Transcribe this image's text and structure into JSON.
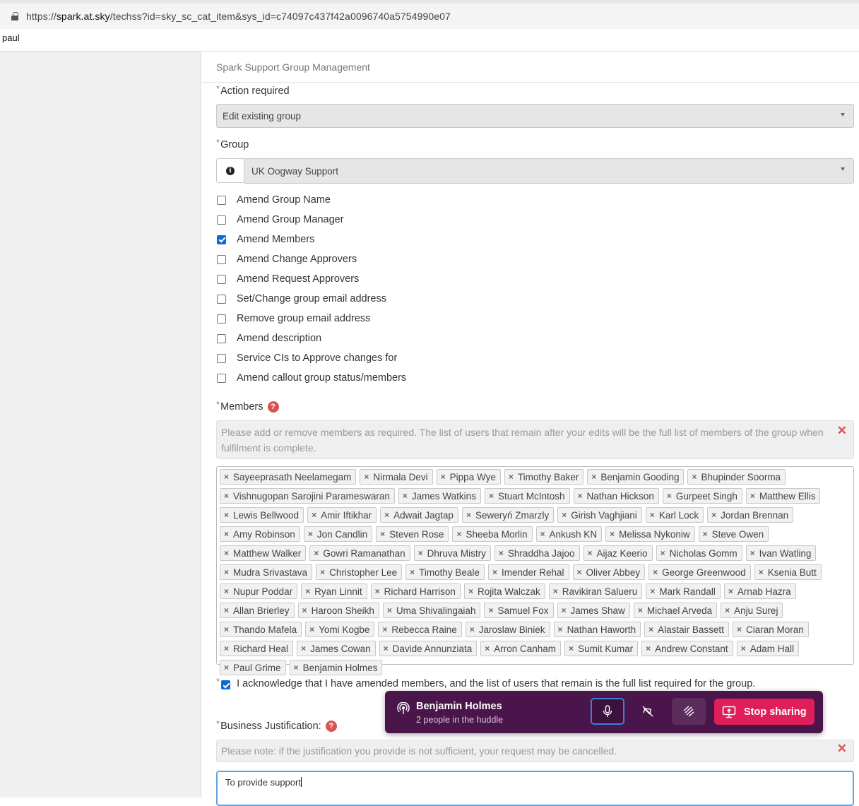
{
  "browser": {
    "url_prefix": "https://",
    "url_host": "spark.at.sky",
    "url_path": "/techss?id=sky_sc_cat_item&sys_id=c74097c437f42a0096740a5754990e07",
    "user": "paul"
  },
  "form": {
    "title": "Spark Support Group Management",
    "action": {
      "label": "Action required",
      "value": "Edit existing group"
    },
    "group": {
      "label": "Group",
      "value": "UK Oogway Support"
    },
    "options": [
      {
        "label": "Amend Group Name",
        "checked": false
      },
      {
        "label": "Amend Group Manager",
        "checked": false
      },
      {
        "label": "Amend Members",
        "checked": true
      },
      {
        "label": "Amend Change Approvers",
        "checked": false
      },
      {
        "label": "Amend Request Approvers",
        "checked": false
      },
      {
        "label": "Set/Change group email address",
        "checked": false
      },
      {
        "label": "Remove group email address",
        "checked": false
      },
      {
        "label": "Amend description",
        "checked": false
      },
      {
        "label": "Service CIs to Approve changes for",
        "checked": false
      },
      {
        "label": "Amend callout group status/members",
        "checked": false
      }
    ],
    "members": {
      "label": "Members",
      "help": "?",
      "notice": "Please add or remove members as required.  The list of users that remain after your edits will be the full list of members of the group when fulfilment is complete.",
      "list": [
        "Sayeeprasath Neelamegam",
        "Nirmala Devi",
        "Pippa Wye",
        "Timothy Baker",
        "Benjamin Gooding",
        "Bhupinder Soorma",
        "Vishnugopan Sarojini Parameswaran",
        "James Watkins",
        "Stuart McIntosh",
        "Nathan Hickson",
        "Gurpeet Singh",
        "Matthew Ellis",
        "Lewis Bellwood",
        "Amir Iftikhar",
        "Adwait Jagtap",
        "Seweryń Zmarzly",
        "Girish Vaghjiani",
        "Karl Lock",
        "Jordan Brennan",
        "Amy Robinson",
        "Jon Candlin",
        "Steven Rose",
        "Sheeba Morlin",
        "Ankush KN",
        "Melissa Nykoniw",
        "Steve Owen",
        "Matthew Walker",
        "Gowri Ramanathan",
        "Dhruva Mistry",
        "Shraddha Jajoo",
        "Aijaz Keerio",
        "Nicholas Gomm",
        "Ivan Watling",
        "Mudra Srivastava",
        "Christopher Lee",
        "Timothy Beale",
        "Imender Rehal",
        "Oliver Abbey",
        "George Greenwood",
        "Ksenia Butt",
        "Nupur Poddar",
        "Ryan Linnit",
        "Richard Harrison",
        "Rojita Walczak",
        "Ravikiran Salueru",
        "Mark Randall",
        "Arnab Hazra",
        "Allan Brierley",
        "Haroon Sheikh",
        "Uma Shivalingaiah",
        "Samuel Fox",
        "James Shaw",
        "Michael Arveda",
        "Anju Surej",
        "Thando Mafela",
        "Yomi Kogbe",
        "Rebecca Raine",
        "Jaroslaw Biniek",
        "Nathan Haworth",
        "Alastair Bassett",
        "Ciaran Moran",
        "Richard Heal",
        "James Cowan",
        "Davide Annunziata",
        "Arron Canham",
        "Sumit Kumar",
        "Andrew Constant",
        "Adam Hall",
        "Paul Grime",
        "Benjamin Holmes"
      ]
    },
    "acknowledge": {
      "label": "I acknowledge that I have amended members, and the list of users that remain is the full list required for the group.",
      "checked": true
    },
    "justification": {
      "label": "Business Justification:",
      "help": "?",
      "notice": "Please note: if the justification you provide is not sufficient, your request may be cancelled.",
      "value": "To provide support"
    }
  },
  "huddle": {
    "name": "Benjamin Holmes",
    "subtitle": "2 people in the huddle",
    "stop_label": "Stop sharing",
    "accent": "#4a154b",
    "stop_color": "#e01e5a"
  }
}
